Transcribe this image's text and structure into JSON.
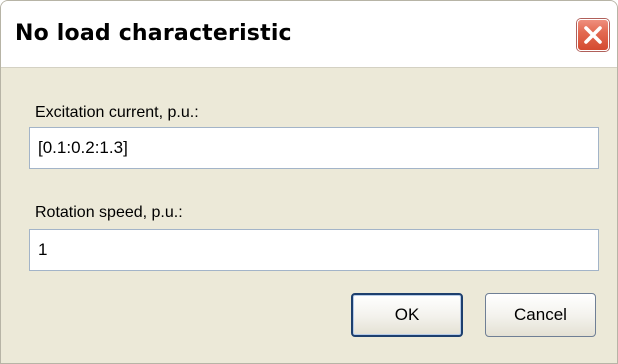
{
  "dialog": {
    "title": "No load characteristic",
    "close_icon": "close-x-icon"
  },
  "fields": {
    "excitation": {
      "label": "Excitation current, p.u.:",
      "value": "[0.1:0.2:1.3]"
    },
    "rotation": {
      "label": "Rotation speed, p.u.:",
      "value": "1"
    }
  },
  "buttons": {
    "ok_label": "OK",
    "cancel_label": "Cancel"
  },
  "colors": {
    "dialog_background": "#ece9d8",
    "close_button": "#d44a30",
    "default_button_border": "#1d3f6e"
  }
}
